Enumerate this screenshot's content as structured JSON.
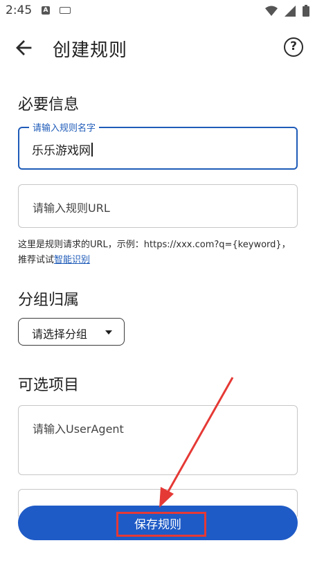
{
  "status_bar": {
    "time": "2:45",
    "notification_icons": [
      "a-icon",
      "keyboard-icon"
    ],
    "system_icons": [
      "wifi-icon",
      "signal-icon",
      "battery-icon"
    ]
  },
  "app_bar": {
    "title": "创建规则",
    "back_icon": "arrow-left-icon",
    "help_icon": "question-circle-icon",
    "help_glyph": "?"
  },
  "required_section": {
    "title": "必要信息",
    "name_field": {
      "label": "请输入规则名字",
      "value": "乐乐游戏网"
    },
    "url_field": {
      "placeholder": "请输入规则URL"
    },
    "helper_text": "这里是规则请求的URL，示例：https://xxx.com?q={keyword}，推荐试试",
    "helper_link": "智能识别"
  },
  "group_section": {
    "title": "分组归属",
    "dropdown_label": "请选择分组"
  },
  "optional_section": {
    "title": "可选项目",
    "useragent_field": {
      "placeholder": "请输入UserAgent"
    }
  },
  "footer": {
    "save_label": "保存规则"
  },
  "colors": {
    "accent": "#1e5bb8",
    "save_button": "#1f5bc6",
    "annotation": "#e53935"
  }
}
